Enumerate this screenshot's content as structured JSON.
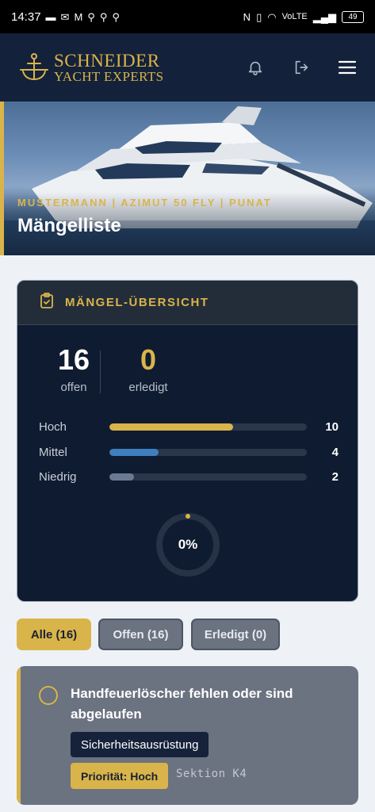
{
  "status_bar": {
    "time": "14:37",
    "left_icons": [
      "sim-icon",
      "mail-icon",
      "m-mail-icon",
      "hub-icon",
      "hub-icon",
      "hub-icon"
    ],
    "network": "VoLTE",
    "battery": "49"
  },
  "header": {
    "brand_line1": "SCHNEIDER",
    "brand_line2": "YACHT EXPERTS",
    "icons": [
      "bell-icon",
      "logout-icon",
      "menu-icon"
    ]
  },
  "hero": {
    "subtitle": "MUSTERMANN | AZIMUT 50 FLY | PUNAT",
    "title": "Mängelliste"
  },
  "overview": {
    "title": "MÄNGEL-ÜBERSICHT",
    "open_count": "16",
    "open_label": "offen",
    "done_count": "0",
    "done_label": "erledigt",
    "priorities": [
      {
        "label": "Hoch",
        "value": "10",
        "fraction": 0.625,
        "color": "#d9b44a"
      },
      {
        "label": "Mittel",
        "value": "4",
        "fraction": 0.25,
        "color": "#3f7fc0"
      },
      {
        "label": "Niedrig",
        "value": "2",
        "fraction": 0.125,
        "color": "#6b7a92"
      }
    ],
    "progress_label": "0%",
    "progress_fraction": 0
  },
  "filters": {
    "all": "Alle (16)",
    "open": "Offen (16)",
    "done": "Erledigt (0)"
  },
  "items": [
    {
      "title": "Handfeuerlöscher fehlen oder sind abgelaufen",
      "category": "Sicherheitsausrüstung",
      "priority": "Priorität: Hoch",
      "section": "Sektion K4"
    }
  ],
  "colors": {
    "accent": "#d9b44a",
    "navy": "#14213a",
    "card": "#0f1b30"
  }
}
